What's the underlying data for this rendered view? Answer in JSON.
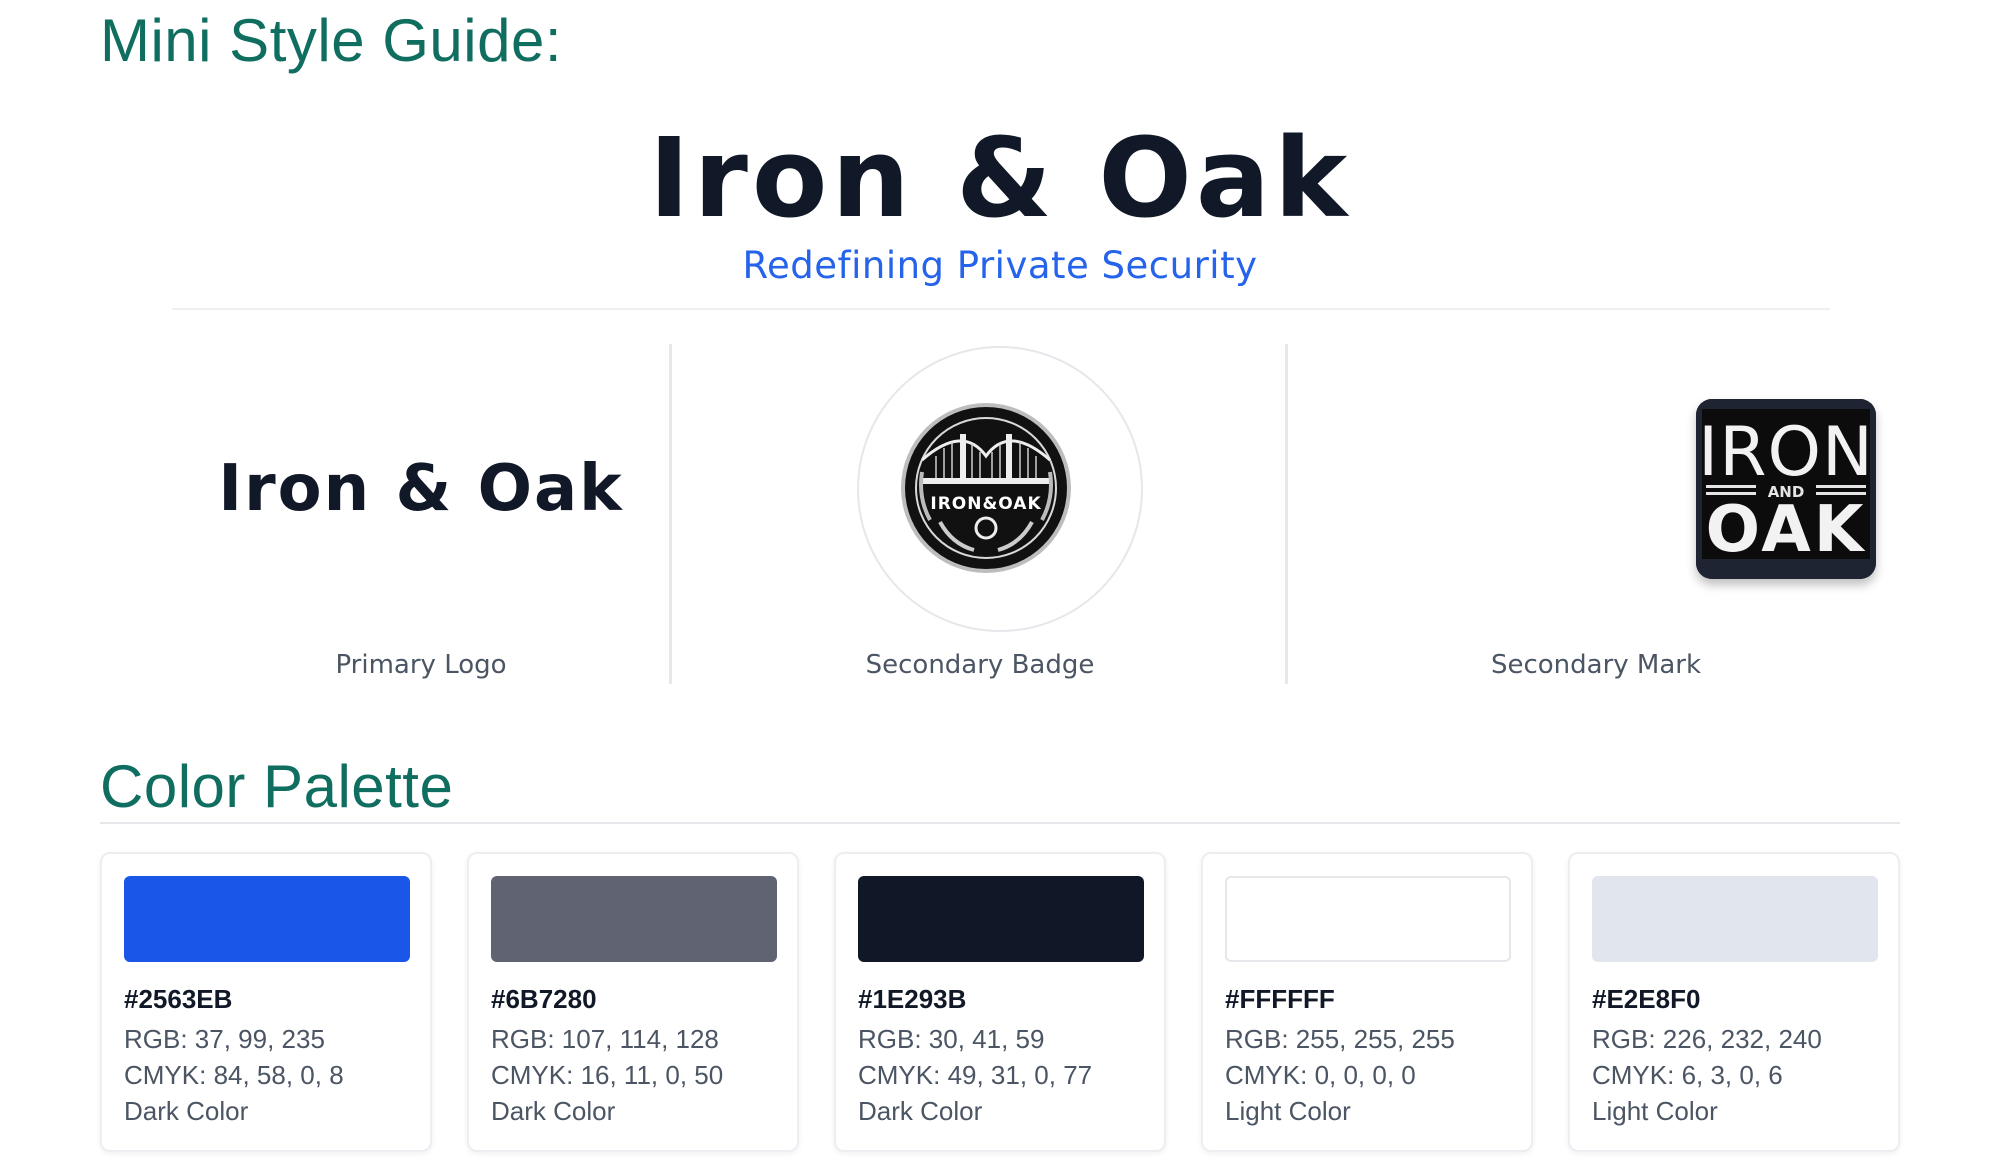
{
  "header": {
    "title": "Mini Style Guide:"
  },
  "hero": {
    "brand": "Iron & Oak",
    "tagline": "Redefining Private Security"
  },
  "logos": [
    {
      "caption": "Primary Logo",
      "text": "Iron & Oak"
    },
    {
      "caption": "Secondary Badge",
      "badge_text": "IRON&OAK"
    },
    {
      "caption": "Secondary Mark",
      "mark_line1": "IRON",
      "mark_line2": "AND",
      "mark_line3": "OAK"
    }
  ],
  "palette": {
    "title": "Color Palette",
    "colors": [
      {
        "hex": "#2563EB",
        "rgb": "RGB: 37, 99, 235",
        "cmyk": "CMYK: 84, 58, 0, 8",
        "tone": "Dark Color",
        "swatch": "#1a56e8"
      },
      {
        "hex": "#6B7280",
        "rgb": "RGB: 107, 114, 128",
        "cmyk": "CMYK: 16, 11, 0, 50",
        "tone": "Dark Color",
        "swatch": "#5f6372"
      },
      {
        "hex": "#1E293B",
        "rgb": "RGB: 30, 41, 59",
        "cmyk": "CMYK: 49, 31, 0, 77",
        "tone": "Dark Color",
        "swatch": "#101827"
      },
      {
        "hex": "#FFFFFF",
        "rgb": "RGB: 255, 255, 255",
        "cmyk": "CMYK: 0, 0, 0, 0",
        "tone": "Light Color",
        "swatch": "#ffffff"
      },
      {
        "hex": "#E2E8F0",
        "rgb": "RGB: 226, 232, 240",
        "cmyk": "CMYK: 6, 3, 0, 6",
        "tone": "Light Color",
        "swatch": "#e1e5ee"
      }
    ]
  }
}
